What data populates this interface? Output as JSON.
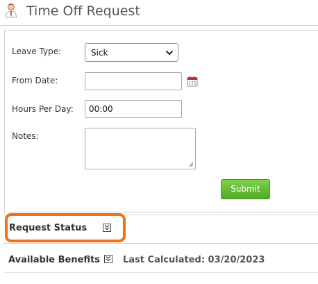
{
  "header": {
    "title": "Time Off Request",
    "icon": "person-icon"
  },
  "form": {
    "leave_type": {
      "label": "Leave Type:",
      "selected": "Sick"
    },
    "from_date": {
      "label": "From Date:",
      "value": ""
    },
    "hours_per_day": {
      "label": "Hours Per Day:",
      "value": "00:00"
    },
    "notes": {
      "label": "Notes:",
      "value": ""
    },
    "submit_label": "Submit"
  },
  "sections": {
    "request_status": "Request Status",
    "available_benefits": "Available Benefits",
    "last_calculated": "Last Calculated: 03/20/2023"
  },
  "colors": {
    "accent_highlight": "#f07216",
    "submit_green": "#5cb82a"
  }
}
